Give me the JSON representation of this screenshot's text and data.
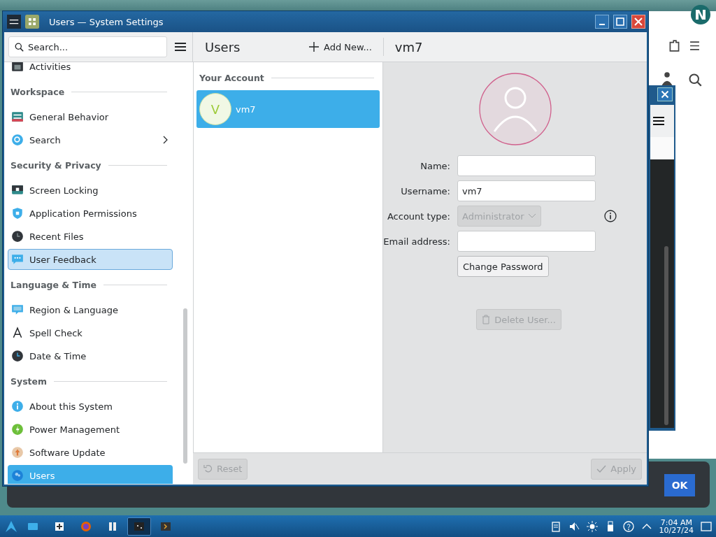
{
  "window": {
    "title": "Users — System Settings"
  },
  "search": {
    "placeholder": "Search..."
  },
  "header": {
    "page_title": "Users",
    "add_button": "Add New...",
    "detail_title": "vm7"
  },
  "sidebar": {
    "groups": [
      {
        "items": [
          {
            "label": "Activities",
            "selected": false,
            "hovered": false
          }
        ]
      },
      {
        "heading": "Workspace",
        "items": [
          {
            "label": "General Behavior",
            "selected": false,
            "hovered": false
          },
          {
            "label": "Search",
            "selected": false,
            "hovered": false,
            "expandable": true
          }
        ]
      },
      {
        "heading": "Security & Privacy",
        "items": [
          {
            "label": "Screen Locking",
            "selected": false,
            "hovered": false
          },
          {
            "label": "Application Permissions",
            "selected": false,
            "hovered": false
          },
          {
            "label": "Recent Files",
            "selected": false,
            "hovered": false
          },
          {
            "label": "User Feedback",
            "selected": false,
            "hovered": true
          }
        ]
      },
      {
        "heading": "Language & Time",
        "items": [
          {
            "label": "Region & Language",
            "selected": false,
            "hovered": false
          },
          {
            "label": "Spell Check",
            "selected": false,
            "hovered": false
          },
          {
            "label": "Date & Time",
            "selected": false,
            "hovered": false
          }
        ]
      },
      {
        "heading": "System",
        "items": [
          {
            "label": "About this System",
            "selected": false,
            "hovered": false
          },
          {
            "label": "Power Management",
            "selected": false,
            "hovered": false
          },
          {
            "label": "Software Update",
            "selected": false,
            "hovered": false
          },
          {
            "label": "Users",
            "selected": true,
            "hovered": false
          }
        ]
      }
    ]
  },
  "accounts": {
    "heading": "Your Account",
    "users": [
      {
        "initial": "V",
        "name": "vm7",
        "selected": true
      }
    ]
  },
  "form": {
    "fields": [
      {
        "label": "Name:",
        "kind": "text"
      },
      {
        "label": "Username:",
        "kind": "text",
        "value": "vm7"
      },
      {
        "label": "Account type:",
        "kind": "select",
        "value": "Administrator",
        "disabled": true
      },
      {
        "label": "Email address:",
        "kind": "text"
      }
    ],
    "change_password": "Change Password",
    "delete_user": {
      "label": "Delete User...",
      "disabled": true
    }
  },
  "footer": {
    "reset": {
      "label": "Reset",
      "disabled": true
    },
    "apply": {
      "label": "Apply",
      "disabled": true
    }
  },
  "notification": {
    "button": "OK"
  },
  "taskbar": {
    "apps": [
      {
        "selected": false
      },
      {
        "selected": false
      },
      {
        "selected": false
      },
      {
        "selected": false
      },
      {
        "selected": true
      },
      {
        "selected": false
      }
    ],
    "time": "7:04 AM",
    "date": "10/27/24"
  }
}
